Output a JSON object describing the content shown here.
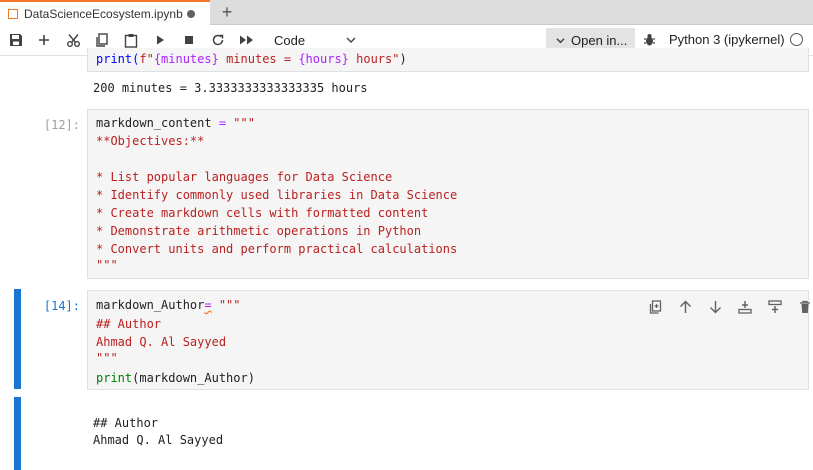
{
  "tab": {
    "title": "DataScienceEcosystem.ipynb",
    "new_tab": "+"
  },
  "toolbar": {
    "cell_type": "Code",
    "open_in": "Open in...",
    "kernel": "Python 3 (ipykernel)",
    "icons": [
      "save-icon",
      "add-cell-icon",
      "cut-icon",
      "copy-icon",
      "paste-icon",
      "run-icon",
      "stop-icon",
      "restart-icon",
      "run-all-icon"
    ]
  },
  "cells": {
    "prev_cell": {
      "line1": {
        "a": "print(",
        "b": "f\"",
        "c": "{minutes}",
        "d": " minutes = ",
        "e": "{hours}",
        "f": " hours\"",
        "g": ")"
      },
      "output": "200 minutes = 3.3333333333333335 hours"
    },
    "cell12": {
      "prompt": "[12]:",
      "lines": [
        {
          "a": "markdown_content",
          "b": " = ",
          "c": "\"\"\""
        },
        "**Objectives:**",
        "",
        "* List popular languages for Data Science",
        "* Identify commonly used libraries in Data Science",
        "* Create markdown cells with formatted content",
        "* Demonstrate arithmetic operations in Python",
        "* Convert units and perform practical calculations",
        "\"\"\""
      ]
    },
    "cell14": {
      "prompt": "[14]:",
      "line1": {
        "a": "markdown_Author",
        "b": "=",
        "c": " \"\"\""
      },
      "lines": [
        "## Author",
        "Ahmad Q. Al Sayyed",
        "\"\"\""
      ],
      "line5": {
        "a": "print",
        "b": "(markdown_Author)"
      },
      "output": [
        "## Author",
        "Ahmad Q. Al Sayyed"
      ]
    }
  }
}
